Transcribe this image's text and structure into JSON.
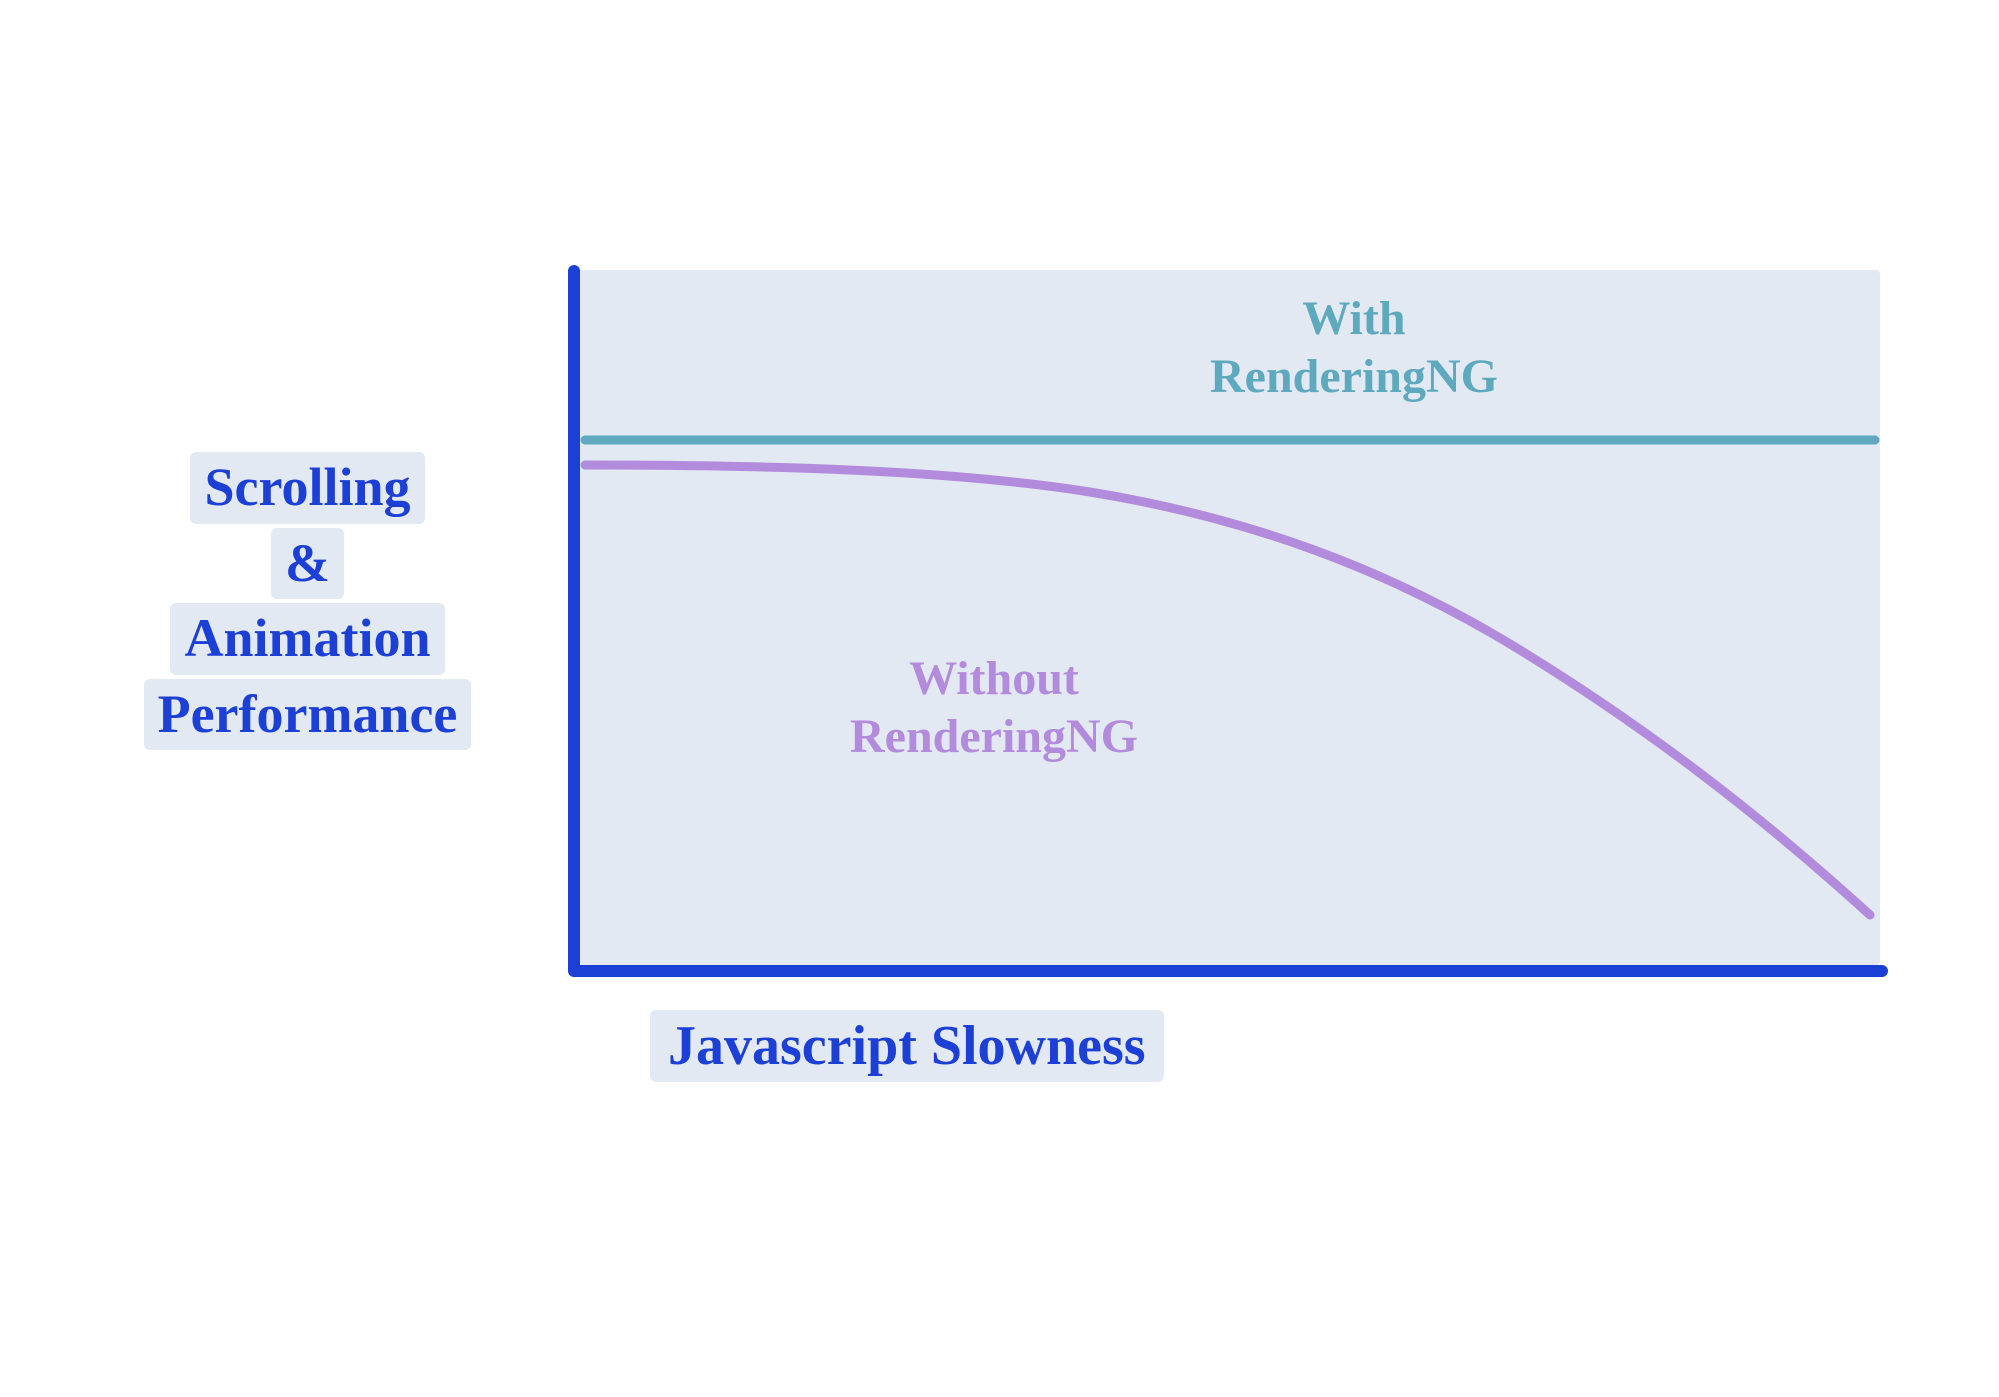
{
  "chart_data": {
    "type": "line",
    "title": "",
    "xlabel": "Javascript Slowness",
    "ylabel_lines": [
      "Scrolling",
      "&",
      "Animation",
      "Performance"
    ],
    "x": [
      0,
      10,
      20,
      30,
      40,
      50,
      60,
      70,
      80,
      90,
      100
    ],
    "series": [
      {
        "name": "With RenderingNG",
        "color": "#5ea9bd",
        "values": [
          78,
          78,
          78,
          78,
          78,
          78,
          78,
          78,
          78,
          78,
          78
        ]
      },
      {
        "name": "Without RenderingNG",
        "color": "#b38bdc",
        "values": [
          75,
          75,
          74,
          73,
          71,
          68,
          63,
          56,
          46,
          32,
          14
        ]
      }
    ],
    "ylim": [
      0,
      100
    ],
    "xlim": [
      0,
      100
    ],
    "axes_visible": true,
    "grid": false,
    "legend_position": "inline"
  },
  "labels": {
    "y1": "Scrolling",
    "y2": "&",
    "y3": "Animation",
    "y4": "Performance",
    "x": "Javascript Slowness",
    "series_with_l1": "With",
    "series_with_l2": "RenderingNG",
    "series_without_l1": "Without",
    "series_without_l2": "RenderingNG"
  }
}
